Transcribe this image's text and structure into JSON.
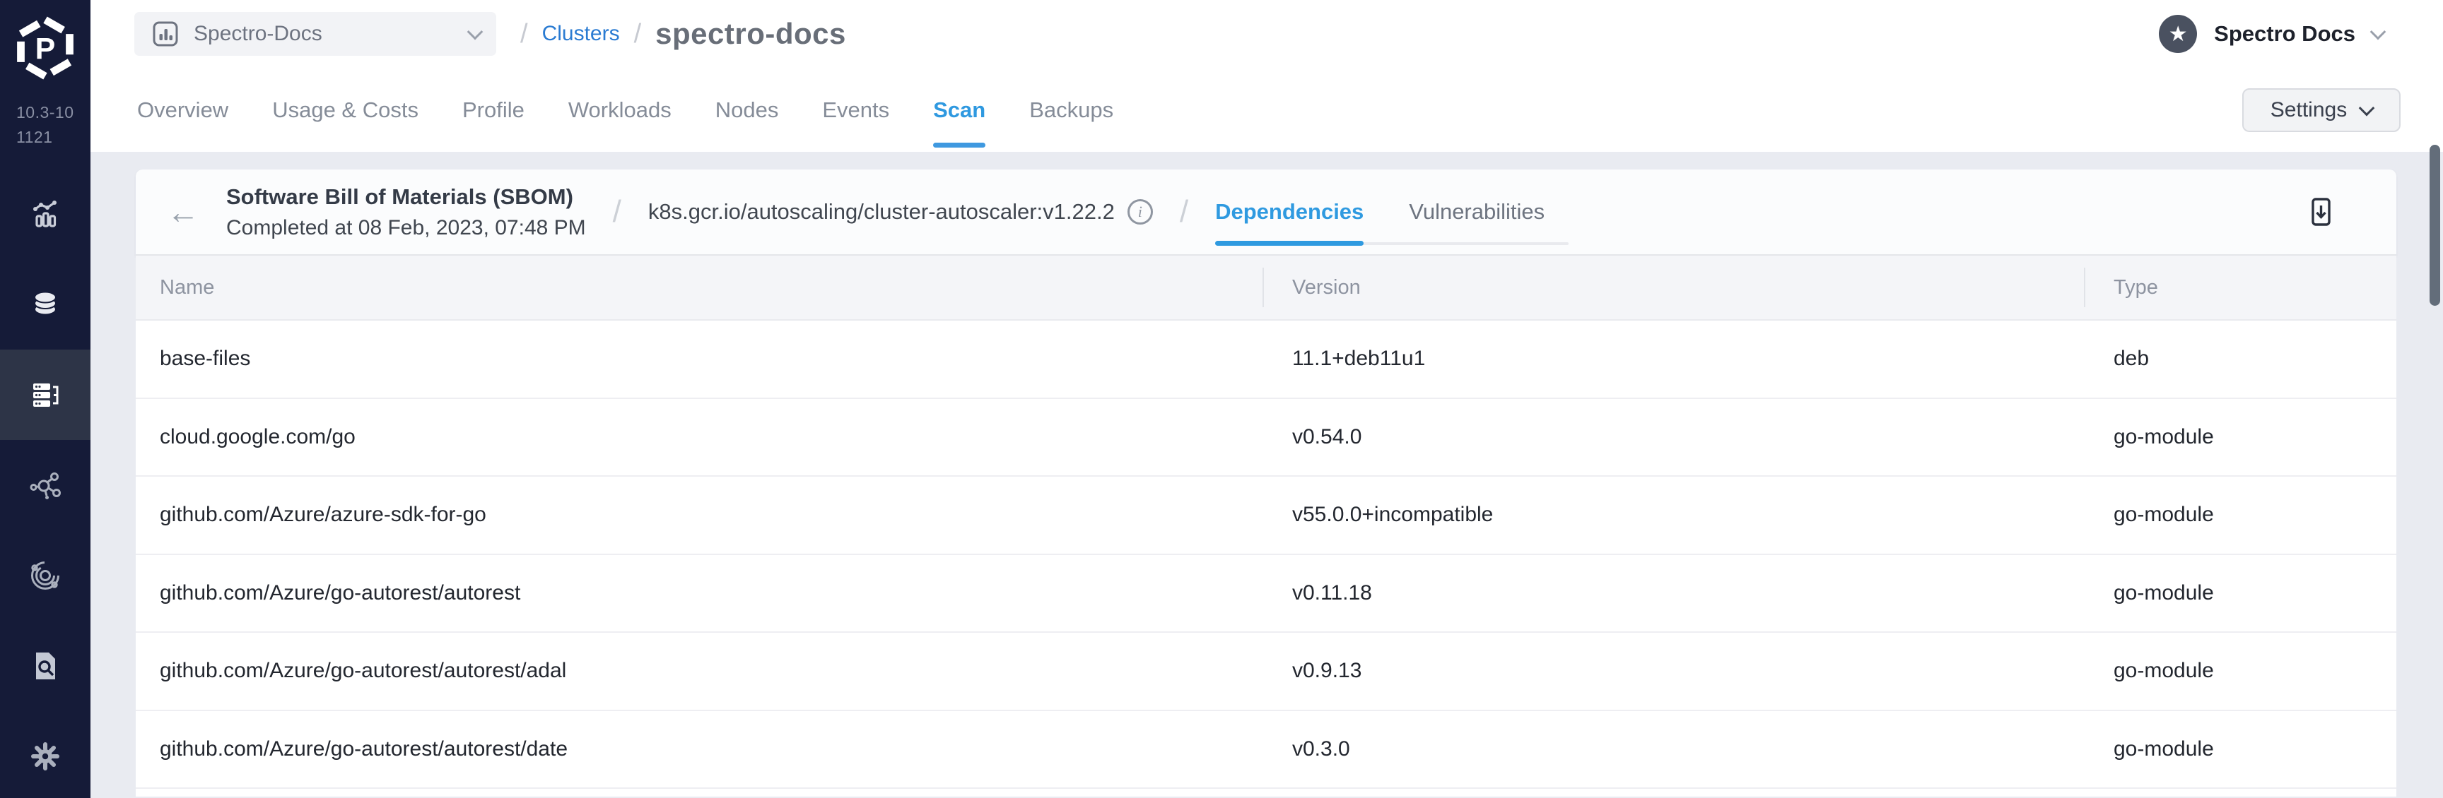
{
  "app": {
    "version": "10.3-101121"
  },
  "colors": {
    "sidebar_bg": "#151b38",
    "accent_blue": "#2f99e0",
    "link_blue": "#2a7bd2",
    "page_bg": "#e9ebf1"
  },
  "sidebar": {
    "items": [
      {
        "id": "monitoring",
        "icon": "analytics-icon",
        "active": false
      },
      {
        "id": "profiles",
        "icon": "layers-icon",
        "active": false
      },
      {
        "id": "clusters",
        "icon": "clusters-icon",
        "active": true
      },
      {
        "id": "workspaces",
        "icon": "network-icon",
        "active": false
      },
      {
        "id": "ecosystem",
        "icon": "orbit-icon",
        "active": false
      },
      {
        "id": "audit",
        "icon": "doc-search-icon",
        "active": false
      },
      {
        "id": "settings",
        "icon": "gear-icon",
        "active": false
      }
    ]
  },
  "icons": {
    "star": "★",
    "back_arrow": "←",
    "info": "i"
  },
  "header": {
    "project_selector": "Spectro-Docs",
    "breadcrumb": {
      "separator": "/",
      "link": "Clusters",
      "current": "spectro-docs"
    },
    "tenant": "Spectro Docs"
  },
  "tabs": {
    "items": [
      "Overview",
      "Usage & Costs",
      "Profile",
      "Workloads",
      "Nodes",
      "Events",
      "Scan",
      "Backups"
    ],
    "active": "Scan",
    "settings": "Settings"
  },
  "scan": {
    "title": "Software Bill of Materials (SBOM)",
    "completed": "Completed at 08 Feb, 2023, 07:48 PM",
    "separator": "/",
    "image": "k8s.gcr.io/autoscaling/cluster-autoscaler:v1.22.2",
    "tabs": [
      "Dependencies",
      "Vulnerabilities"
    ],
    "active_tab": "Dependencies"
  },
  "table": {
    "columns": [
      "Name",
      "Version",
      "Type"
    ],
    "rows": [
      [
        "base-files",
        "11.1+deb11u1",
        "deb"
      ],
      [
        "cloud.google.com/go",
        "v0.54.0",
        "go-module"
      ],
      [
        "github.com/Azure/azure-sdk-for-go",
        "v55.0.0+incompatible",
        "go-module"
      ],
      [
        "github.com/Azure/go-autorest/autorest",
        "v0.11.18",
        "go-module"
      ],
      [
        "github.com/Azure/go-autorest/autorest/adal",
        "v0.9.13",
        "go-module"
      ],
      [
        "github.com/Azure/go-autorest/autorest/date",
        "v0.3.0",
        "go-module"
      ]
    ]
  }
}
